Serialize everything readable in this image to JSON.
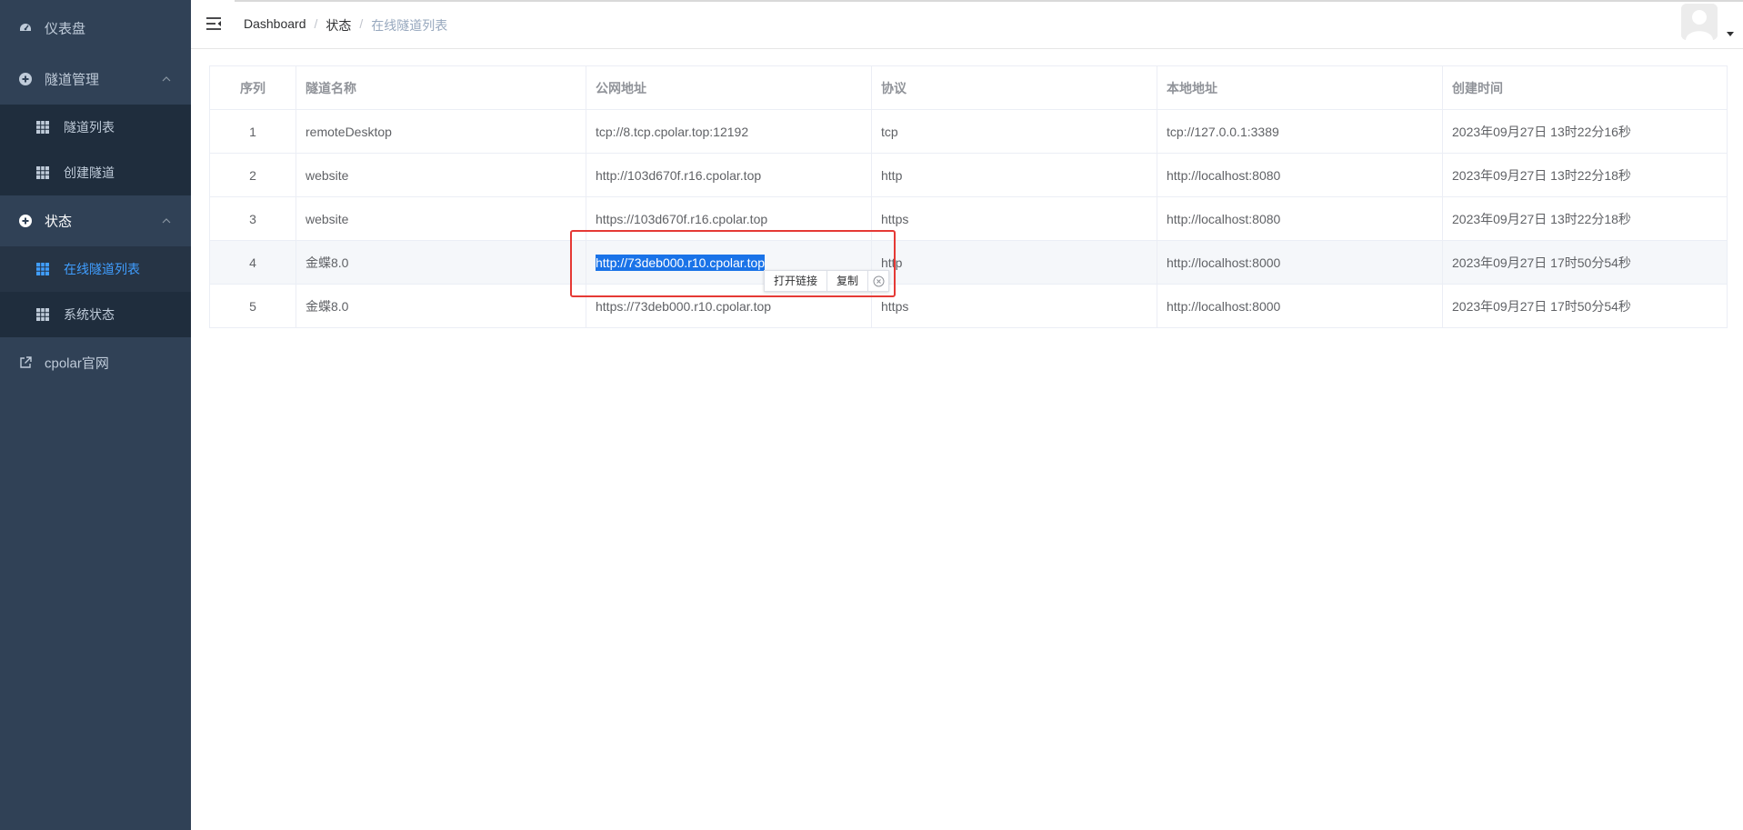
{
  "sidebar": {
    "dashboard": "仪表盘",
    "tunnel_mgmt": "隧道管理",
    "tunnel_list": "隧道列表",
    "create_tunnel": "创建隧道",
    "status": "状态",
    "online_tunnels": "在线隧道列表",
    "system_status": "系统状态",
    "official_site": "cpolar官网"
  },
  "breadcrumb": {
    "b1": "Dashboard",
    "sep": "/",
    "b2": "状态",
    "b3": "在线隧道列表"
  },
  "table": {
    "headers": [
      "序列",
      "隧道名称",
      "公网地址",
      "协议",
      "本地地址",
      "创建时间"
    ],
    "rows": [
      [
        "1",
        "remoteDesktop",
        "tcp://8.tcp.cpolar.top:12192",
        "tcp",
        "tcp://127.0.0.1:3389",
        "2023年09月27日 13时22分16秒"
      ],
      [
        "2",
        "website",
        "http://103d670f.r16.cpolar.top",
        "http",
        "http://localhost:8080",
        "2023年09月27日 13时22分18秒"
      ],
      [
        "3",
        "website",
        "https://103d670f.r16.cpolar.top",
        "https",
        "http://localhost:8080",
        "2023年09月27日 13时22分18秒"
      ],
      [
        "4",
        "金蝶8.0",
        "http://73deb000.r10.cpolar.top",
        "http",
        "http://localhost:8000",
        "2023年09月27日 17时50分54秒"
      ],
      [
        "5",
        "金蝶8.0",
        "https://73deb000.r10.cpolar.top",
        "https",
        "http://localhost:8000",
        "2023年09月27日 17时50分54秒"
      ]
    ]
  },
  "popup": {
    "open_link": "打开链接",
    "copy": "复制"
  },
  "colors": {
    "sidebar_bg": "#304156",
    "submenu_bg": "#1f2d3d",
    "active": "#409eff",
    "annotation": "#e53935"
  },
  "icons": [
    "dashboard-icon",
    "plus-circle-icon",
    "grid-icon",
    "external-link-icon",
    "hamburger-icon",
    "avatar-icon",
    "close-circle-icon"
  ]
}
